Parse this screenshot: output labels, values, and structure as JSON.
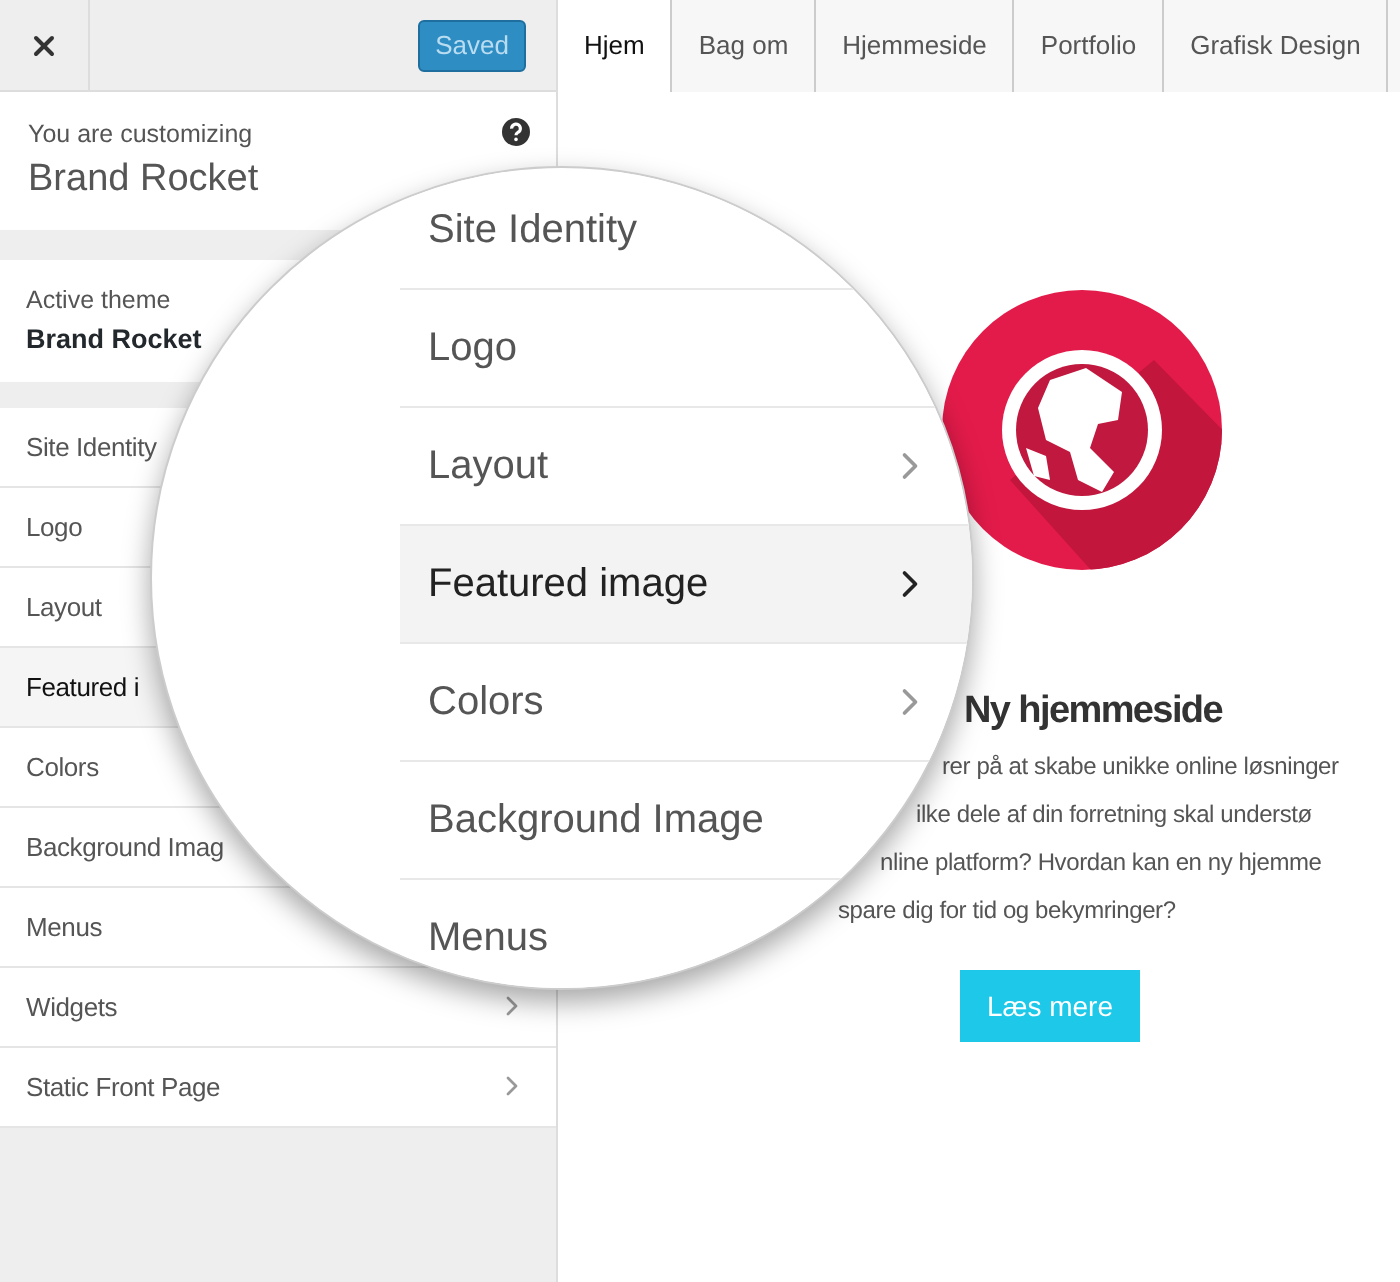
{
  "header": {
    "save_button": "Saved"
  },
  "info": {
    "caption": "You are customizing",
    "site": "Brand Rocket"
  },
  "theme": {
    "caption": "Active theme",
    "name": "Brand Rocket"
  },
  "sidebar": {
    "items": [
      {
        "label": "Site Identity",
        "selected": false
      },
      {
        "label": "Logo",
        "selected": false
      },
      {
        "label": "Layout",
        "selected": false
      },
      {
        "label": "Featured i",
        "selected": true
      },
      {
        "label": "Colors",
        "selected": false
      },
      {
        "label": "Background Imag",
        "selected": false
      },
      {
        "label": "Menus",
        "selected": false
      },
      {
        "label": "Widgets",
        "selected": false,
        "chevron": true
      },
      {
        "label": "Static Front Page",
        "selected": false,
        "chevron": true
      }
    ]
  },
  "tabs": [
    {
      "label": "Hjem",
      "selected": true
    },
    {
      "label": "Bag om",
      "selected": false
    },
    {
      "label": "Hjemmeside",
      "selected": false
    },
    {
      "label": "Portfolio",
      "selected": false
    },
    {
      "label": "Grafisk Design",
      "selected": false
    }
  ],
  "preview": {
    "heading": "Ny hjemmeside",
    "lines": [
      "rer på at skabe unikke online løsninger",
      "ilke dele af din forretning skal understø",
      "nline platform? Hvordan kan en ny hjemme",
      "spare dig for tid og bekymringer?"
    ],
    "button": "Læs mere"
  },
  "magnifier": {
    "items": [
      {
        "label": "Site Identity",
        "selected": false
      },
      {
        "label": "Logo",
        "selected": false,
        "chevron": false
      },
      {
        "label": "Layout",
        "selected": false,
        "chevron": true
      },
      {
        "label": "Featured image",
        "selected": true,
        "chevron": true
      },
      {
        "label": "Colors",
        "selected": false,
        "chevron": true
      },
      {
        "label": "Background Image",
        "selected": false
      },
      {
        "label": "Menus",
        "selected": false
      }
    ]
  }
}
